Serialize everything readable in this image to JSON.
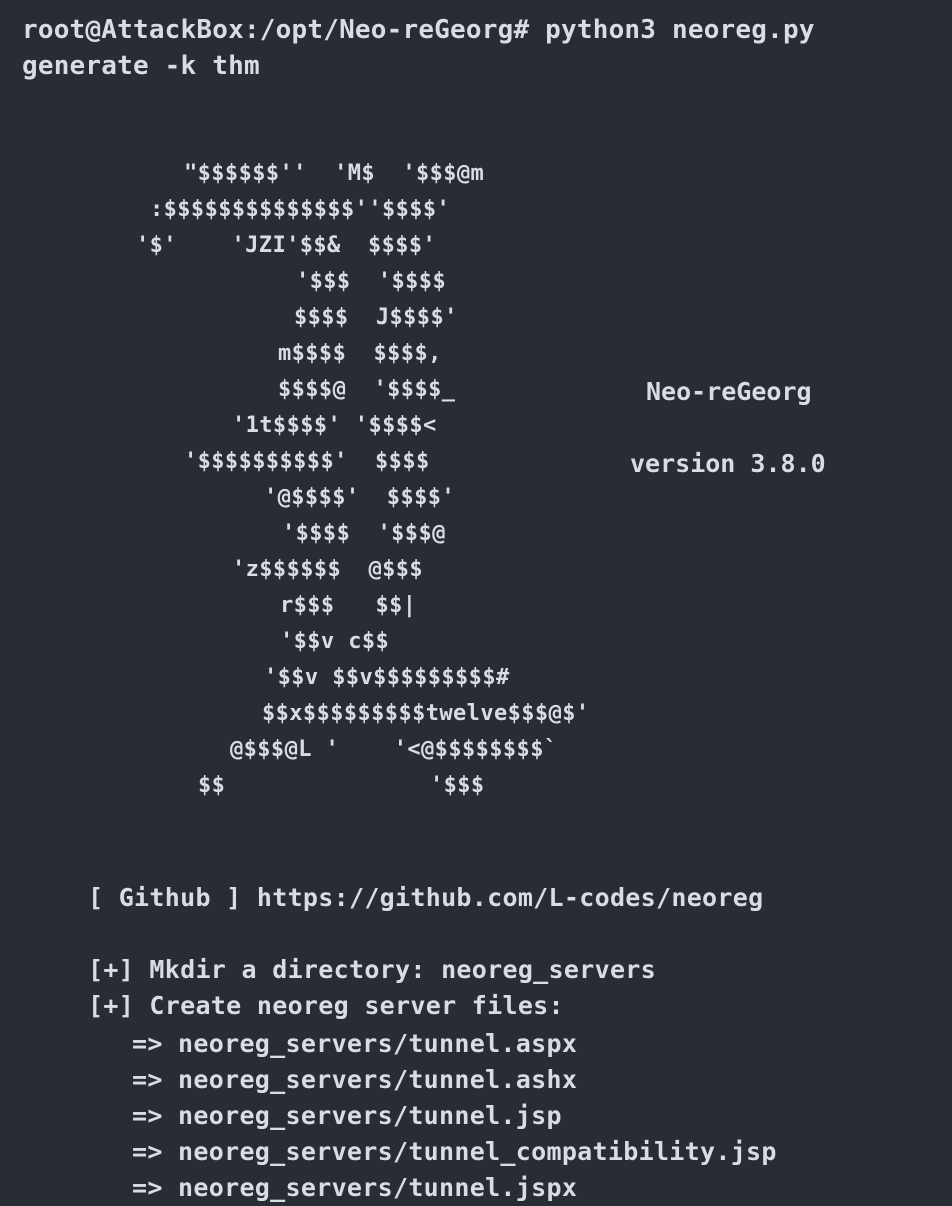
{
  "terminal": {
    "prompt": "root@AttackBox:/opt/Neo-reGeorg#",
    "command_line1": "root@AttackBox:/opt/Neo-reGeorg# python3 neoreg.py",
    "command_line2": "generate -k thm"
  },
  "banner": {
    "art": [
      "\"$$$$$$''  'M$  '$$$@m",
      ":$$$$$$$$$$$$$$''$$$$'",
      "'$'    'JZI'$$&  $$$$'",
      "'$$$  '$$$$",
      "$$$$  J$$$$'",
      "m$$$$  $$$$,",
      "$$$$@  '$$$$_",
      "'1t$$$$' '$$$$<",
      "'$$$$$$$$$$'  $$$$",
      "'@$$$$'  $$$$'",
      "'$$$$  '$$$@",
      "'z$$$$$$  @$$$",
      "r$$$   $$|",
      "'$$v c$$",
      "'$$v $$v$$$$$$$$$#",
      "$$x$$$$$$$$$twelve$$$@$'",
      "@$$$@L '    '<@$$$$$$$$`",
      "$$               '$$$"
    ],
    "name": "Neo-reGeorg",
    "version": "version 3.8.0"
  },
  "output": {
    "github": "[ Github ] https://github.com/L-codes/neoreg",
    "mkdir": "[+] Mkdir a directory: neoreg_servers",
    "create": "[+] Create neoreg server files:",
    "files": [
      "=> neoreg_servers/tunnel.aspx",
      "=> neoreg_servers/tunnel.ashx",
      "=> neoreg_servers/tunnel.jsp",
      "=> neoreg_servers/tunnel_compatibility.jsp",
      "=> neoreg_servers/tunnel.jspx"
    ]
  },
  "colors": {
    "background": "#282c34",
    "text": "#d8dce3"
  }
}
